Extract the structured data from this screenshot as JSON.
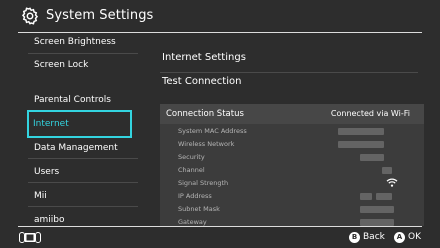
{
  "header": {
    "title": "System Settings",
    "icon": "gear-icon"
  },
  "sidebar": {
    "items": [
      {
        "label": "Screen Brightness"
      },
      {
        "label": "Screen Lock"
      },
      {
        "label": "Parental Controls"
      },
      {
        "label": "Internet",
        "selected": true
      },
      {
        "label": "Data Management"
      },
      {
        "label": "Users"
      },
      {
        "label": "Mii"
      },
      {
        "label": "amiibo"
      }
    ],
    "accent_color": "#33d4e0"
  },
  "main": {
    "options": [
      {
        "label": "Internet Settings"
      },
      {
        "label": "Test Connection"
      }
    ],
    "connection_status": {
      "label": "Connection Status",
      "value": "Connected via Wi-Fi",
      "rows": [
        {
          "label": "System MAC Address"
        },
        {
          "label": "Wireless Network"
        },
        {
          "label": "Security"
        },
        {
          "label": "Channel"
        },
        {
          "label": "Signal Strength",
          "icon": "wifi-signal-icon"
        },
        {
          "label": "IP Address"
        },
        {
          "label": "Subnet Mask"
        },
        {
          "label": "Gateway"
        }
      ]
    }
  },
  "footer": {
    "controller_icon": "switch-console-icon",
    "back": {
      "button": "B",
      "label": "Back"
    },
    "ok": {
      "button": "A",
      "label": "OK"
    }
  }
}
